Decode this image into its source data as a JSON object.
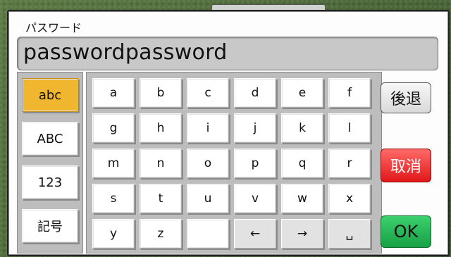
{
  "dialog": {
    "title": "パスワード"
  },
  "input": {
    "value": "passwordpassword"
  },
  "modes": [
    {
      "label": "abc",
      "active": true
    },
    {
      "label": "ABC",
      "active": false
    },
    {
      "label": "123",
      "active": false
    },
    {
      "label": "記号",
      "active": false
    }
  ],
  "keys": [
    [
      "a",
      "b",
      "c",
      "d",
      "e",
      "f"
    ],
    [
      "g",
      "h",
      "i",
      "j",
      "k",
      "l"
    ],
    [
      "m",
      "n",
      "o",
      "p",
      "q",
      "r"
    ],
    [
      "s",
      "t",
      "u",
      "v",
      "w",
      "x"
    ],
    [
      "y",
      "z",
      "",
      "←",
      "→",
      "␣"
    ]
  ],
  "buttons": {
    "backspace": "後退",
    "cancel": "取消",
    "ok": "OK"
  },
  "colors": {
    "active_mode": "#f1b62f",
    "cancel": "#e01818",
    "ok": "#18a045",
    "background": "#4f6a3c"
  }
}
